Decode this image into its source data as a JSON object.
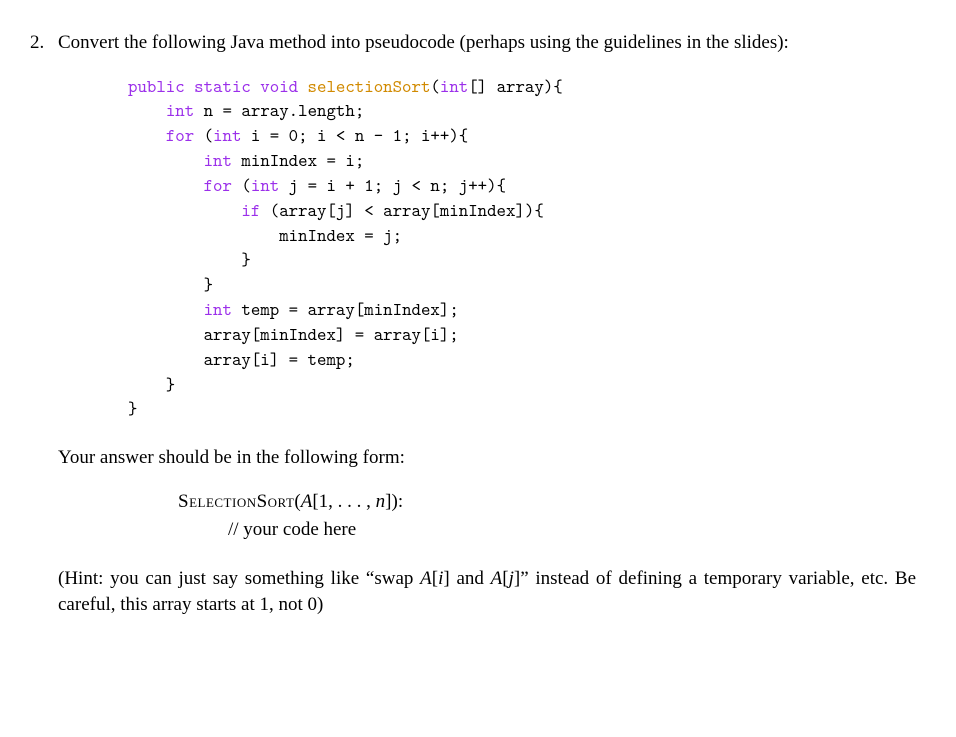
{
  "problem_number": "2.",
  "question": "Convert the following Java method into pseudocode (perhaps using the guidelines in the slides):",
  "code": {
    "l1_pre": "",
    "l1_kw1": "public static void",
    "l1_fn": " selectionSort",
    "l1_post1": "(",
    "l1_ty": "int",
    "l1_post2": "[] array){",
    "l2_pad": "    ",
    "l2_ty": "int",
    "l2_rest": " n = array.length;",
    "l3_pad": "    ",
    "l3_kw": "for",
    "l3_mid": " (",
    "l3_ty": "int",
    "l3_rest": " i = 0; i < n - 1; i++){",
    "l4_pad": "        ",
    "l4_ty": "int",
    "l4_rest": " minIndex = i;",
    "l5_pad": "        ",
    "l5_kw": "for",
    "l5_mid": " (",
    "l5_ty": "int",
    "l5_rest": " j = i + 1; j < n; j++){",
    "l6_pad": "            ",
    "l6_kw": "if",
    "l6_rest": " (array[j] < array[minIndex]){",
    "l7": "                minIndex = j;",
    "l8": "            }",
    "l9": "        }",
    "l10_pad": "        ",
    "l10_ty": "int",
    "l10_rest": " temp = array[minIndex];",
    "l11": "        array[minIndex] = array[i];",
    "l12": "        array[i] = temp;",
    "l13": "    }",
    "l14": "}"
  },
  "answer_intro": "Your answer should be in the following form:",
  "pseudo": {
    "name": "SelectionSort",
    "args_open": "(",
    "arg_A": "A",
    "args_mid": "[1, . . . , ",
    "arg_n": "n",
    "args_close": "]):",
    "comment": "// your code here"
  },
  "hint_open": "(Hint:  you can just say something like “swap ",
  "hint_Ai_A": "A",
  "hint_Ai_open": "[",
  "hint_Ai_i": "i",
  "hint_Ai_close": "]",
  "hint_mid": " and ",
  "hint_Aj_A": "A",
  "hint_Aj_open": "[",
  "hint_Aj_j": "j",
  "hint_Aj_close": "]",
  "hint_close": "” instead of defining a temporary variable, etc. Be careful, this array starts at 1, not 0)"
}
